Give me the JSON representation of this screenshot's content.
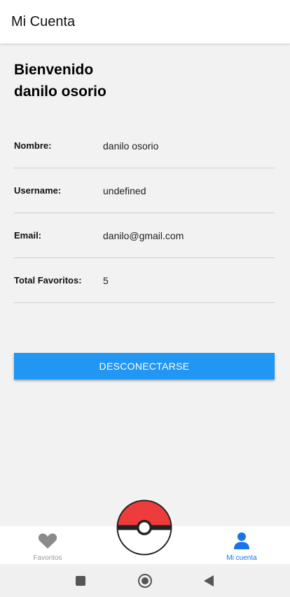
{
  "app_bar": {
    "title": "Mi Cuenta"
  },
  "welcome": {
    "line1": "Bienvenido",
    "line2": "danilo osorio"
  },
  "profile": {
    "rows": [
      {
        "label": "Nombre:",
        "value": "danilo osorio"
      },
      {
        "label": "Username:",
        "value": "undefined"
      },
      {
        "label": "Email:",
        "value": "danilo@gmail.com"
      },
      {
        "label": "Total Favoritos:",
        "value": "5"
      }
    ]
  },
  "logout_button": {
    "label": "DESCONECTARSE"
  },
  "bottom_nav": {
    "items": [
      {
        "label": "Favoritos",
        "icon": "heart-icon",
        "active": false
      },
      {
        "label": "Mi cuenta",
        "icon": "person-icon",
        "active": true
      }
    ],
    "center_icon": "pokeball-icon"
  },
  "system_nav": {
    "buttons": [
      "recents-button",
      "home-button",
      "back-button"
    ]
  },
  "colors": {
    "accent": "#2196f3",
    "active_nav": "#1a73e8",
    "inactive_nav": "#9a9a9a",
    "pokeball_red": "#ee3c3c"
  }
}
